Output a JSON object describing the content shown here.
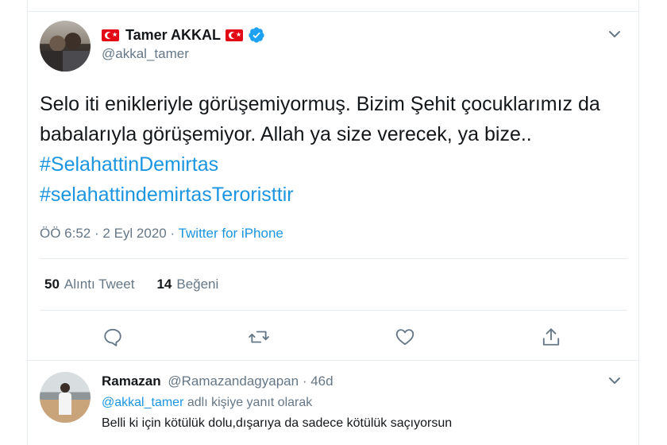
{
  "tweet": {
    "display_name": "Tamer AKKAL",
    "handle": "@akkal_tamer",
    "text_plain": "Selo iti enikleriyle görüşemiyormuş. Bizim Şehit çocuklarımız da babalarıyla görüşemiyor. Allah ya size verecek, ya bize.. ",
    "hashtag_1": "#SelahattinDemirtas",
    "hashtag_2": "#selahattindemirtasTeroristtir",
    "time": "ÖÖ 6:52",
    "date": "2 Eyl 2020",
    "separator": "·",
    "source": "Twitter for iPhone",
    "quote_count": "50",
    "quote_label": "Alıntı Tweet",
    "like_count": "14",
    "like_label": "Beğeni"
  },
  "icons": {
    "flag": "turkey-flag-icon",
    "verified": "verified-badge-icon",
    "more": "chevron-down-icon",
    "reply": "reply-icon",
    "retweet": "retweet-icon",
    "like": "heart-icon",
    "share": "share-icon"
  },
  "reply": {
    "display_name": "Ramazan",
    "handle": "@Ramazandagyapan",
    "separator": "·",
    "age": "46d",
    "reply_mention": "@akkal_tamer",
    "reply_suffix": "adlı kişiye yanıt olarak",
    "text": "Belli ki için kötülük dolu,dışarıya da sadece kötülük saçıyorsun"
  },
  "colors": {
    "link": "#1b95e0",
    "secondary_text": "#657786",
    "primary_text": "#14171a",
    "flag_red": "#e30a17",
    "border": "#e6ecf0"
  }
}
